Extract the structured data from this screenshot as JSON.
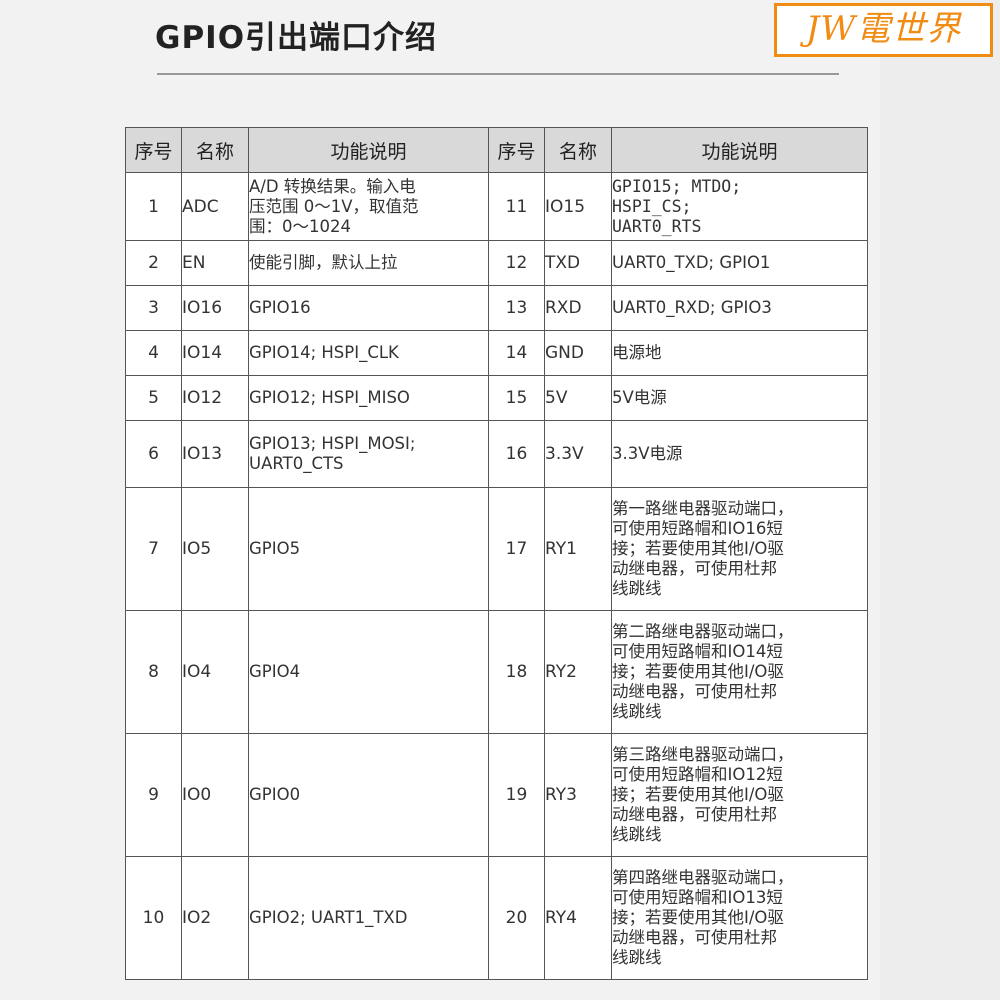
{
  "title": "GPIO引出端口介绍",
  "logo_text": "JW電世界",
  "headers": [
    "序号",
    "名称",
    "功能说明",
    "序号",
    "名称",
    "功能说明"
  ],
  "rows": [
    {
      "no1": "1",
      "name1": "ADC",
      "desc1": "A/D 转换结果。输入电\n压范围 0～1V，取值范\n围：0～1024",
      "no2": "11",
      "name2": "IO15",
      "desc2": "GPIO15; MTDO;\nHSPI_CS;\nUART0_RTS"
    },
    {
      "no1": "2",
      "name1": "EN",
      "desc1": "使能引脚，默认上拉",
      "no2": "12",
      "name2": "TXD",
      "desc2": "UART0_TXD; GPIO1"
    },
    {
      "no1": "3",
      "name1": "IO16",
      "desc1": "GPIO16",
      "no2": "13",
      "name2": "RXD",
      "desc2": "UART0_RXD; GPIO3"
    },
    {
      "no1": "4",
      "name1": "IO14",
      "desc1": "GPIO14; HSPI_CLK",
      "no2": "14",
      "name2": "GND",
      "desc2": "电源地"
    },
    {
      "no1": "5",
      "name1": "IO12",
      "desc1": "GPIO12; HSPI_MISO",
      "no2": "15",
      "name2": "5V",
      "desc2": "5V电源"
    },
    {
      "no1": "6",
      "name1": "IO13",
      "desc1": "GPIO13; HSPI_MOSI;\nUART0_CTS",
      "no2": "16",
      "name2": "3.3V",
      "desc2": "3.3V电源"
    },
    {
      "no1": "7",
      "name1": "IO5",
      "desc1": "GPIO5",
      "no2": "17",
      "name2": "RY1",
      "desc2": "第一路继电器驱动端口，\n可使用短路帽和IO16短\n接；若要使用其他I/O驱\n动继电器，可使用杜邦\n线跳线"
    },
    {
      "no1": "8",
      "name1": "IO4",
      "desc1": "GPIO4",
      "no2": "18",
      "name2": "RY2",
      "desc2": "第二路继电器驱动端口，\n可使用短路帽和IO14短\n接；若要使用其他I/O驱\n动继电器，可使用杜邦\n线跳线"
    },
    {
      "no1": "9",
      "name1": "IO0",
      "desc1": "GPIO0",
      "no2": "19",
      "name2": "RY3",
      "desc2": "第三路继电器驱动端口，\n可使用短路帽和IO12短\n接；若要使用其他I/O驱\n动继电器，可使用杜邦\n线跳线"
    },
    {
      "no1": "10",
      "name1": "IO2",
      "desc1": "GPIO2; UART1_TXD",
      "no2": "20",
      "name2": "RY4",
      "desc2": "第四路继电器驱动端口，\n可使用短路帽和IO13短\n接；若要使用其他I/O驱\n动继电器，可使用杜邦\n线跳线"
    }
  ]
}
